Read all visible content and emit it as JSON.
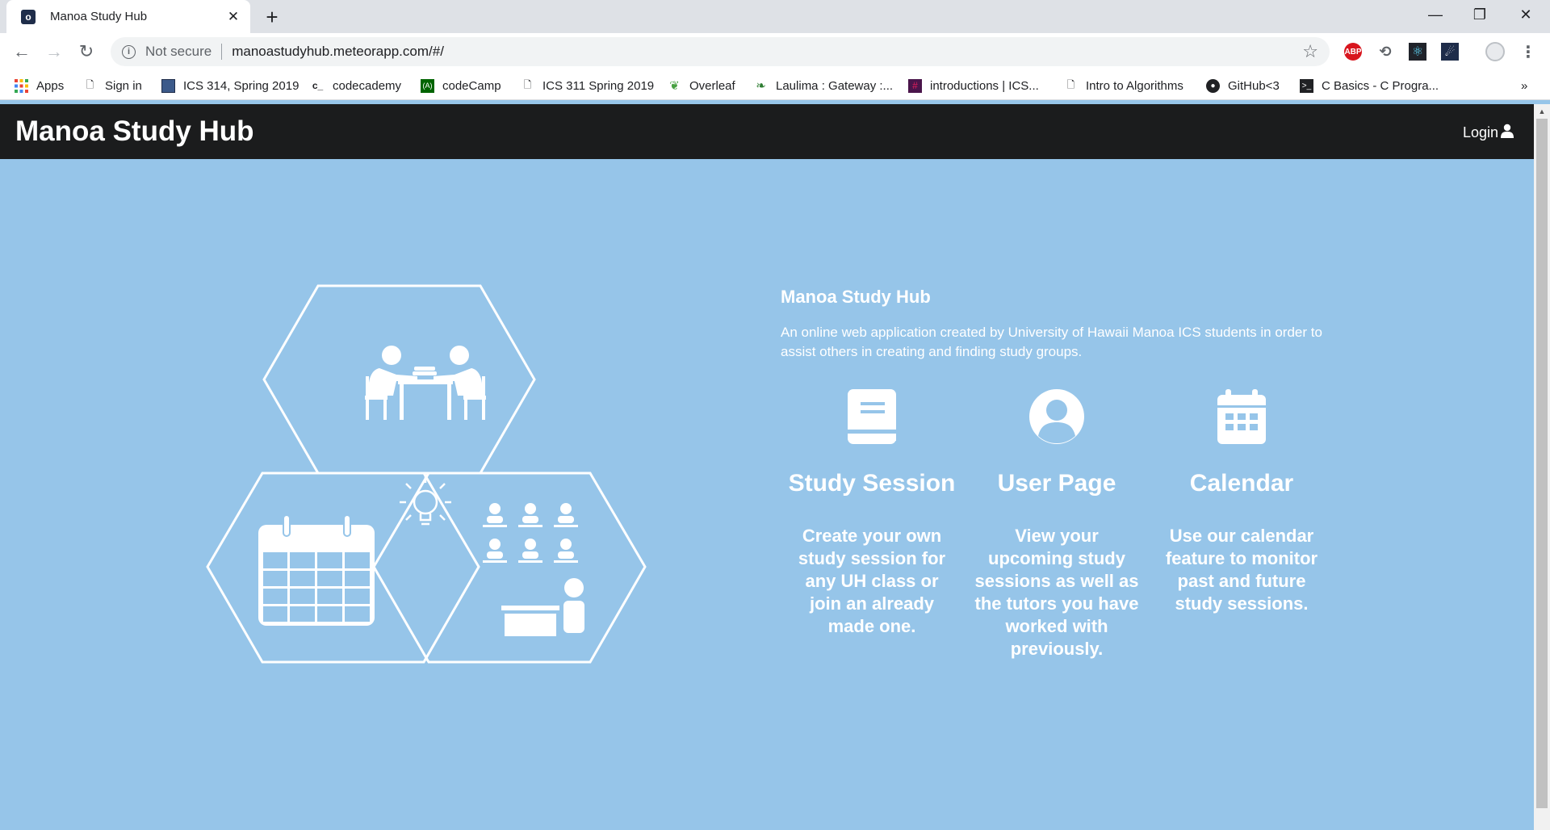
{
  "browser": {
    "tab_title": "Manoa Study Hub",
    "favicon_letter": "o",
    "new_tab": "+",
    "security": "Not secure",
    "url": "manoastudyhub.meteorapp.com/#/",
    "ext_abp": "ABP",
    "bookmarks_more": "»",
    "bookmarks": [
      {
        "label": "Apps"
      },
      {
        "label": "Sign in"
      },
      {
        "label": "ICS 314, Spring 2019"
      },
      {
        "label": "codecademy"
      },
      {
        "label": "codeCamp"
      },
      {
        "label": "ICS 311 Spring 2019"
      },
      {
        "label": "Overleaf"
      },
      {
        "label": "Laulima : Gateway :..."
      },
      {
        "label": "introductions | ICS..."
      },
      {
        "label": "Intro to Algorithms"
      },
      {
        "label": "GitHub<3"
      },
      {
        "label": "C Basics - C Progra..."
      }
    ]
  },
  "page": {
    "brand": "Manoa Study Hub",
    "login_label": "Login",
    "intro_title": "Manoa Study Hub",
    "intro_text": "An online web application created by University of Hawaii Manoa ICS students in order to assist others in creating and finding study groups.",
    "features": [
      {
        "icon": "book-icon",
        "title": "Study Session",
        "description": "Create your own study session for any UH class or join an already made one."
      },
      {
        "icon": "user-circle-icon",
        "title": "User Page",
        "description": "View your upcoming study sessions as well as the tutors you have worked with previously."
      },
      {
        "icon": "calendar-icon",
        "title": "Calendar",
        "description": "Use our calendar feature to monitor past and future study sessions."
      }
    ]
  },
  "colors": {
    "background": "#96c5e9",
    "navbar": "#1b1c1d",
    "text": "#ffffff"
  }
}
